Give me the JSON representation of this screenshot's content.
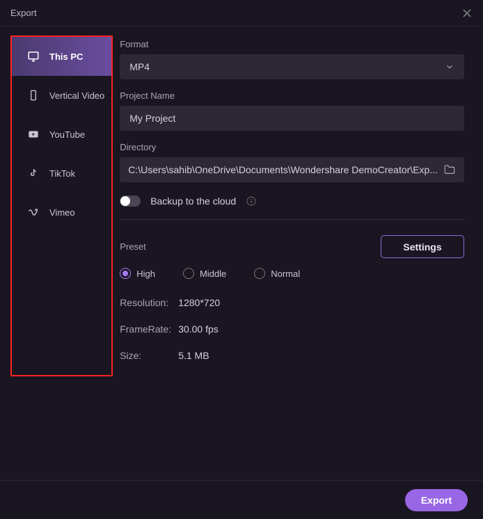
{
  "titlebar": {
    "title": "Export"
  },
  "sidebar": {
    "items": [
      {
        "label": "This PC",
        "icon": "monitor-icon",
        "active": true
      },
      {
        "label": "Vertical Video",
        "icon": "phone-icon",
        "active": false
      },
      {
        "label": "YouTube",
        "icon": "youtube-icon",
        "active": false
      },
      {
        "label": "TikTok",
        "icon": "tiktok-icon",
        "active": false
      },
      {
        "label": "Vimeo",
        "icon": "vimeo-icon",
        "active": false
      }
    ]
  },
  "main": {
    "format": {
      "label": "Format",
      "value": "MP4"
    },
    "projectName": {
      "label": "Project Name",
      "value": "My Project"
    },
    "directory": {
      "label": "Directory",
      "value": "C:\\Users\\sahib\\OneDrive\\Documents\\Wondershare DemoCreator\\Exp..."
    },
    "backup": {
      "label": "Backup to the cloud",
      "enabled": false
    },
    "preset": {
      "label": "Preset",
      "settingsLabel": "Settings",
      "options": [
        {
          "label": "High",
          "selected": true
        },
        {
          "label": "Middle",
          "selected": false
        },
        {
          "label": "Normal",
          "selected": false
        }
      ]
    },
    "specs": [
      {
        "key": "Resolution:",
        "value": "1280*720"
      },
      {
        "key": "FrameRate:",
        "value": "30.00 fps"
      },
      {
        "key": "Size:",
        "value": "5.1 MB"
      }
    ]
  },
  "footer": {
    "exportLabel": "Export"
  }
}
